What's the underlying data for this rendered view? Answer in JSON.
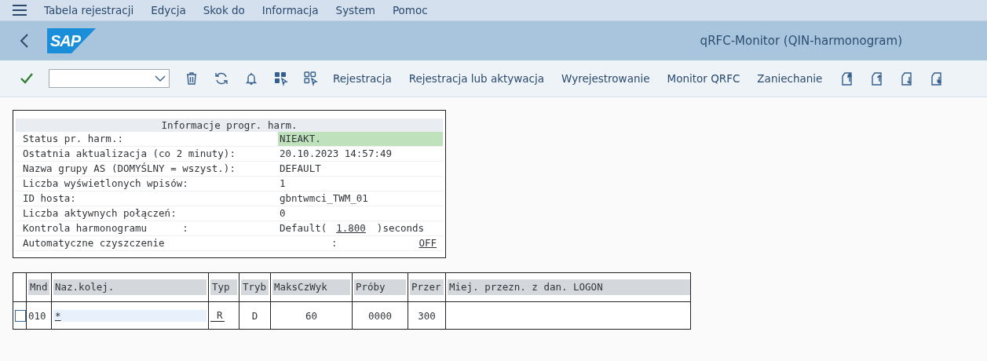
{
  "menu": [
    {
      "label": "Tabela rejestracji"
    },
    {
      "label": "Edycja"
    },
    {
      "label": "Skok do"
    },
    {
      "label": "Informacja"
    },
    {
      "label": "System"
    },
    {
      "label": "Pomoc"
    }
  ],
  "header": {
    "logo": "SAP",
    "title": "qRFC-Monitor (QIN-harmonogram)"
  },
  "toolbar": {
    "buttons": [
      {
        "label": "Rejestracja"
      },
      {
        "label": "Rejestracja lub aktywacja"
      },
      {
        "label": "Wyrejestrowanie"
      },
      {
        "label": "Monitor QRFC"
      },
      {
        "label": "Zaniechanie"
      }
    ]
  },
  "info": {
    "title": "Informacje progr. harm.",
    "rows": [
      {
        "kind": "status",
        "label": "Status pr. harm.:",
        "value": "NIEAKT."
      },
      {
        "kind": "plain",
        "label": "Ostatnia aktualizacja (co 2 minuty):",
        "value": "20.10.2023 14:57:49"
      },
      {
        "kind": "plain",
        "label": "Nazwa grupy AS (DOMYŚLNY = wszyst.):",
        "value": "DEFAULT"
      },
      {
        "kind": "plain",
        "label": "Liczba wyświetlonych wpisów:",
        "value": "1"
      },
      {
        "kind": "plain",
        "label": "ID hosta:",
        "value": "gbntwmci_TWM_01"
      },
      {
        "kind": "plain",
        "label": "Liczba aktywnych połączeń:",
        "value": "0"
      },
      {
        "kind": "interval",
        "label": "Kontrola harmonogramu      :",
        "prefix": "Default(",
        "value": "1.800",
        "suffix": ")seconds"
      },
      {
        "kind": "toggle",
        "label": "Automatyczne czyszczenie",
        "separator": ":",
        "value": "OFF"
      }
    ]
  },
  "table": {
    "columns": [
      "Mnd",
      "Naz.kolej.",
      "Typ",
      "Tryb",
      "MaksCzWyk",
      "Próby",
      "Przer",
      "Miej. przezn. z dan. LOGON"
    ],
    "rows": [
      {
        "selected": false,
        "cells": [
          {
            "kind": "text",
            "text": "010"
          },
          {
            "kind": "input",
            "text": "*"
          },
          {
            "kind": "input",
            "text": "R"
          },
          {
            "kind": "text",
            "text": "D"
          },
          {
            "kind": "text",
            "text": "60"
          },
          {
            "kind": "text",
            "text": "0000"
          },
          {
            "kind": "text",
            "text": "300"
          }
        ]
      }
    ]
  }
}
